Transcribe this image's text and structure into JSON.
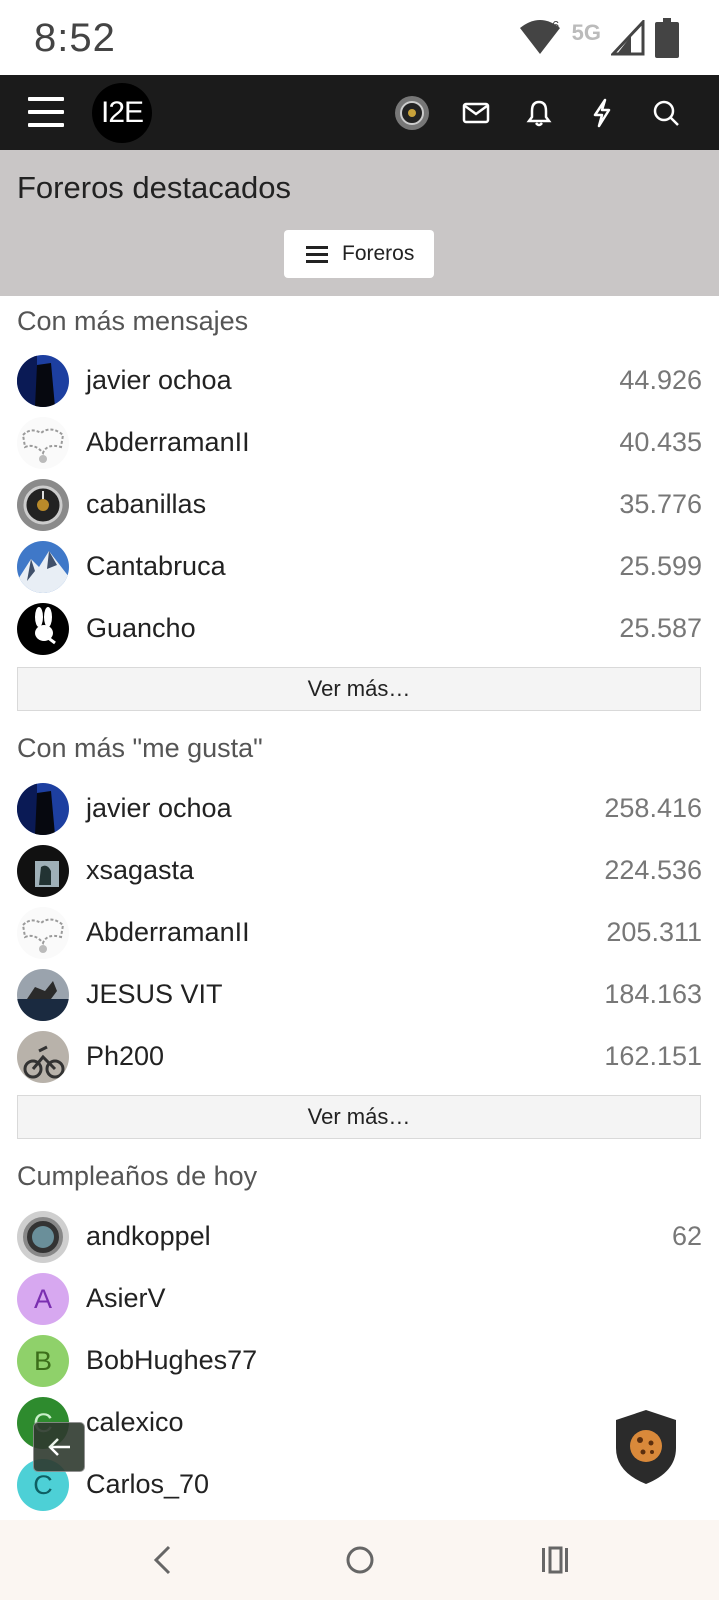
{
  "status_bar": {
    "time": "8:52",
    "network": "5G",
    "wifi_badge": "6"
  },
  "app_bar": {
    "logo_text": "I2E"
  },
  "title_band": {
    "title": "Foreros destacados",
    "filter_button_label": "Foreros"
  },
  "sections": [
    {
      "title": "Con más mensajes",
      "more_label": "Ver más…",
      "members": [
        {
          "name": "javier ochoa",
          "value": "44.926",
          "avatar": "dark-blue-photo"
        },
        {
          "name": "AbderramanII",
          "value": "40.435",
          "avatar": "sketch-photo"
        },
        {
          "name": "cabanillas",
          "value": "35.776",
          "avatar": "watch-photo"
        },
        {
          "name": "Cantabruca",
          "value": "25.599",
          "avatar": "mountain-photo"
        },
        {
          "name": "Guancho",
          "value": "25.587",
          "avatar": "bunny-logo"
        }
      ]
    },
    {
      "title": "Con más \"me gusta\"",
      "more_label": "Ver más…",
      "members": [
        {
          "name": "javier ochoa",
          "value": "258.416",
          "avatar": "dark-blue-photo"
        },
        {
          "name": "xsagasta",
          "value": "224.536",
          "avatar": "dark-photo"
        },
        {
          "name": "AbderramanII",
          "value": "205.311",
          "avatar": "sketch-photo"
        },
        {
          "name": "JESUS VIT",
          "value": "184.163",
          "avatar": "dino-photo"
        },
        {
          "name": "Ph200",
          "value": "162.151",
          "avatar": "motorcycle-photo"
        }
      ]
    },
    {
      "title": "Cumpleaños de hoy",
      "members": [
        {
          "name": "andkoppel",
          "value": "62",
          "avatar": "watch-photo-2"
        },
        {
          "name": "AsierV",
          "value": "",
          "avatar_letter": "A",
          "avatar_bg": "#d7a8f0",
          "avatar_fg": "#7a2fb0"
        },
        {
          "name": "BobHughes77",
          "value": "",
          "avatar_letter": "B",
          "avatar_bg": "#8fd16a",
          "avatar_fg": "#3c6e1a"
        },
        {
          "name": "calexico",
          "value": "",
          "avatar_letter": "C",
          "avatar_bg": "#2e8b2e",
          "avatar_fg": "#c9efc9"
        },
        {
          "name": "Carlos_70",
          "value": "",
          "avatar_letter": "C",
          "avatar_bg": "#4dd0d6",
          "avatar_fg": "#0e5f63"
        }
      ]
    }
  ],
  "icons": {
    "header": [
      "menu-icon",
      "user-avatar-icon",
      "envelope-icon",
      "bell-icon",
      "lightning-icon",
      "search-icon"
    ],
    "floating": [
      "back-arrow-icon",
      "cookie-icon"
    ],
    "nav": [
      "nav-back-icon",
      "nav-home-icon",
      "nav-recents-icon"
    ]
  }
}
